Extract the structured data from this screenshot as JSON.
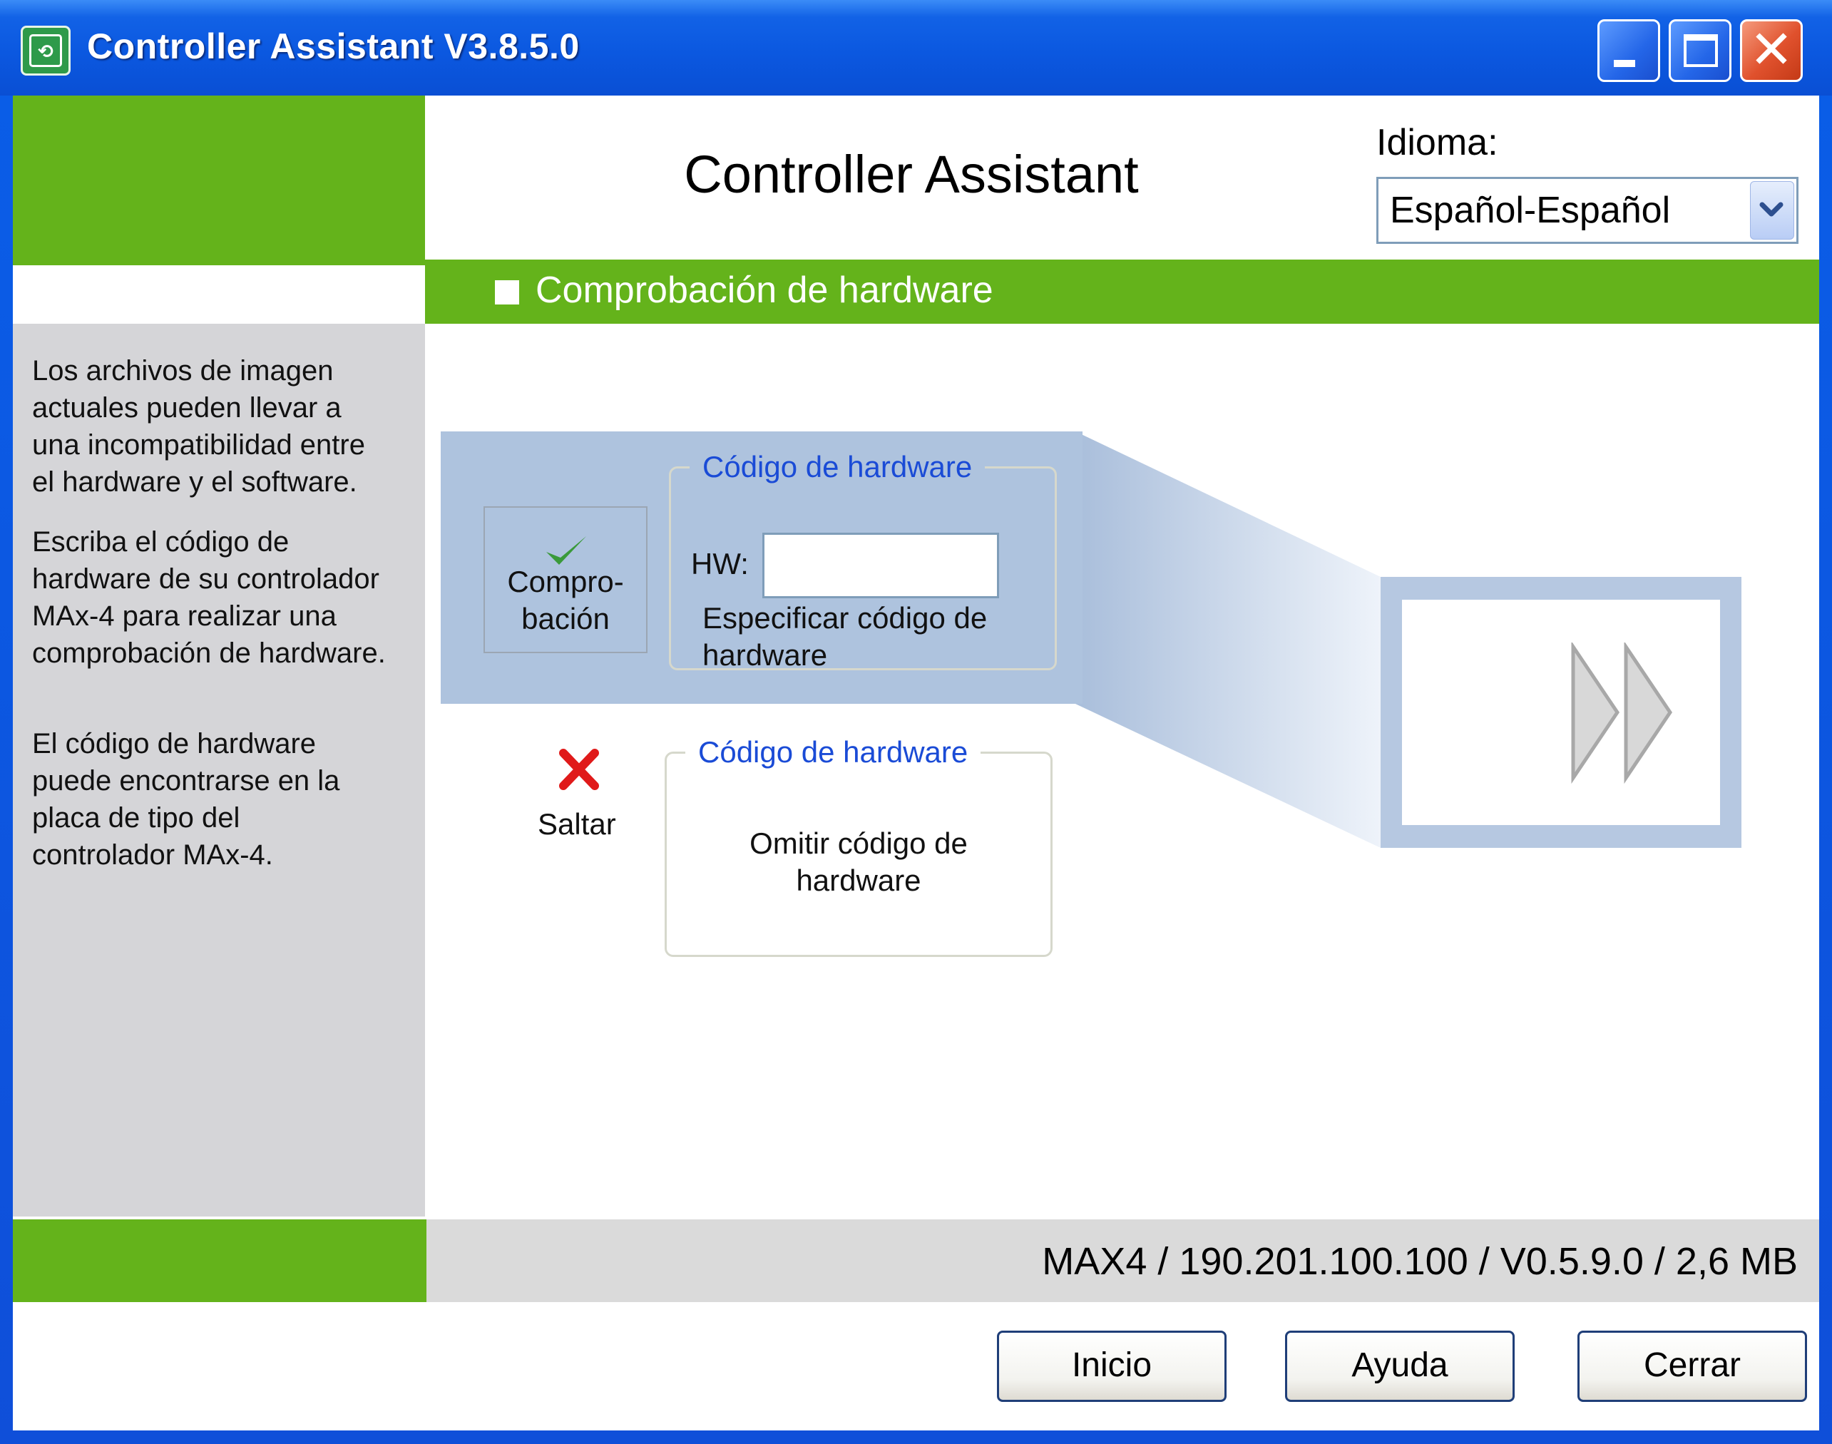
{
  "window": {
    "title": "Controller Assistant V3.8.5.0",
    "icon": "controller-app-icon",
    "controls": {
      "minimize": "minimize-icon",
      "maximize": "maximize-icon",
      "close": "close-icon"
    }
  },
  "header": {
    "app_title": "Controller Assistant",
    "language_label": "Idioma:",
    "language_value": "Español-Español"
  },
  "section": {
    "title": "Comprobación de hardware"
  },
  "sidebar": {
    "paragraph_1": [
      "Los archivos de imagen",
      "actuales pueden llevar a",
      "una incompatibilidad entre",
      "el hardware y el software."
    ],
    "paragraph_2": [
      "Escriba el código de",
      "hardware de su controlador",
      "MAx-4 para realizar una",
      "comprobación de hardware."
    ],
    "paragraph_3": [
      "El código de hardware",
      "puede encontrarse en la",
      "placa de tipo del",
      "controlador MAx-4."
    ]
  },
  "check_option": {
    "label": [
      "Compro-",
      "bación"
    ],
    "legend": "Código de hardware",
    "hw_label": "HW:",
    "hw_value": "",
    "description": [
      "Especificar código de",
      "hardware"
    ]
  },
  "skip_option": {
    "label": "Saltar",
    "legend": "Código de hardware",
    "description": [
      "Omitir código de",
      "hardware"
    ]
  },
  "status": {
    "text": "MAX4 / 190.201.100.100 / V0.5.9.0 / 2,6 MB"
  },
  "buttons": {
    "start": "Inicio",
    "help": "Ayuda",
    "close": "Cerrar"
  },
  "colors": {
    "brand_green": "#64b31b",
    "titlebar_blue": "#0a58e0",
    "legend_blue": "#1a4bd6",
    "check_green": "#3a9a3a",
    "skip_red": "#e01a1a"
  }
}
